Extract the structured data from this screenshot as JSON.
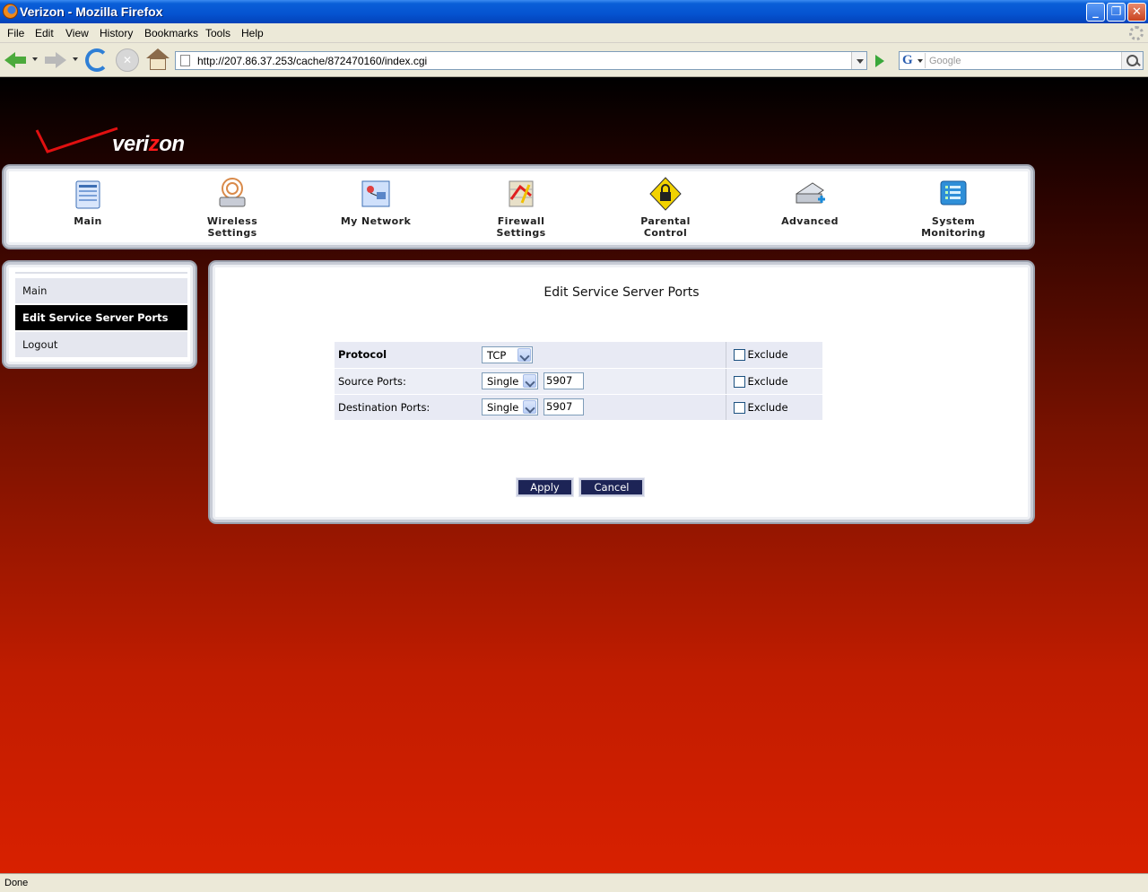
{
  "window": {
    "title": "Verizon - Mozilla Firefox",
    "minimize": "_",
    "maximize": "❐",
    "close": "✕"
  },
  "menu": [
    "File",
    "Edit",
    "View",
    "History",
    "Bookmarks",
    "Tools",
    "Help"
  ],
  "navigation": {
    "url": "http://207.86.37.253/cache/872470160/index.cgi",
    "search_engine": "G",
    "search_placeholder": "Google"
  },
  "brand": {
    "logo_pre": "veri",
    "logo_z": "z",
    "logo_post": "on",
    "accent_color": "#ff1a1a"
  },
  "top_nav": [
    {
      "line1": "Main",
      "line2": "",
      "icon": "main-icon"
    },
    {
      "line1": "Wireless",
      "line2": "Settings",
      "icon": "wireless-icon"
    },
    {
      "line1": "My Network",
      "line2": "",
      "icon": "network-icon"
    },
    {
      "line1": "Firewall",
      "line2": "Settings",
      "icon": "firewall-icon"
    },
    {
      "line1": "Parental",
      "line2": "Control",
      "icon": "lock-icon"
    },
    {
      "line1": "Advanced",
      "line2": "",
      "icon": "scanner-icon"
    },
    {
      "line1": "System",
      "line2": "Monitoring",
      "icon": "monitor-icon"
    }
  ],
  "sidebar": {
    "items": [
      {
        "label": "Main",
        "active": false
      },
      {
        "label": "Edit Service Server Ports",
        "active": true
      },
      {
        "label": "Logout",
        "active": false
      }
    ]
  },
  "form": {
    "heading": "Edit Service Server Ports",
    "rows": [
      {
        "label": "Protocol",
        "select": "TCP",
        "port": "",
        "exclude": "Exclude",
        "checked": false
      },
      {
        "label": "Source Ports:",
        "select": "Single",
        "port": "5907",
        "exclude": "Exclude",
        "checked": false
      },
      {
        "label": "Destination Ports:",
        "select": "Single",
        "port": "5907",
        "exclude": "Exclude",
        "checked": false
      }
    ],
    "apply": "Apply",
    "cancel": "Cancel"
  },
  "status": "Done"
}
